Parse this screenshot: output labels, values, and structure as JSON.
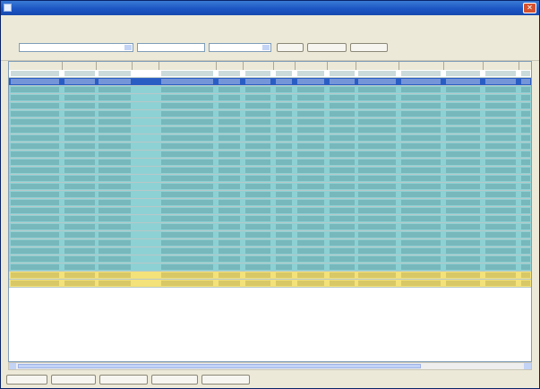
{
  "window": {
    "title": ""
  },
  "menu": [
    {
      "label": ""
    },
    {
      "label": ""
    },
    {
      "label": ""
    },
    {
      "label": ""
    },
    {
      "label": ""
    },
    {
      "label": ""
    },
    {
      "label": ""
    },
    {
      "label": ""
    }
  ],
  "tabs": [
    {
      "label": ""
    },
    {
      "label": ""
    },
    {
      "label": ""
    },
    {
      "label": ""
    }
  ],
  "filter": {
    "field1_value": "",
    "field2_value": "",
    "field3_value": "",
    "search_label": "",
    "clear_label": "",
    "export_label": "",
    "count_label": ""
  },
  "table": {
    "columns": [
      "",
      "",
      "",
      "",
      "",
      "",
      "",
      "",
      "",
      "",
      "",
      "",
      "",
      ""
    ],
    "rows": [
      {
        "status": "normal"
      },
      {
        "status": "selected"
      },
      {
        "status": "highlight"
      },
      {
        "status": "highlight"
      },
      {
        "status": "highlight"
      },
      {
        "status": "highlight"
      },
      {
        "status": "highlight"
      },
      {
        "status": "highlight"
      },
      {
        "status": "highlight"
      },
      {
        "status": "highlight"
      },
      {
        "status": "highlight"
      },
      {
        "status": "highlight"
      },
      {
        "status": "highlight"
      },
      {
        "status": "highlight"
      },
      {
        "status": "highlight"
      },
      {
        "status": "highlight"
      },
      {
        "status": "highlight"
      },
      {
        "status": "highlight"
      },
      {
        "status": "highlight"
      },
      {
        "status": "highlight"
      },
      {
        "status": "highlight"
      },
      {
        "status": "highlight"
      },
      {
        "status": "highlight"
      },
      {
        "status": "highlight"
      },
      {
        "status": "highlight"
      },
      {
        "status": "warning"
      },
      {
        "status": "warning"
      }
    ],
    "row_colors": {
      "normal": "#ffffff",
      "selected": "#2a5dc4",
      "highlight": "#8ed1d4",
      "warning": "#f3e27a"
    }
  },
  "footer": {
    "buttons": [
      {
        "label": ""
      },
      {
        "label": ""
      },
      {
        "label": ""
      },
      {
        "label": ""
      },
      {
        "label": ""
      }
    ]
  },
  "colors": {
    "titlebar": "#1c56c4",
    "window_bg": "#ece9d8",
    "highlight_row": "#8ed1d4",
    "warning_row": "#f3e27a",
    "selected_row": "#2a5dc4"
  }
}
